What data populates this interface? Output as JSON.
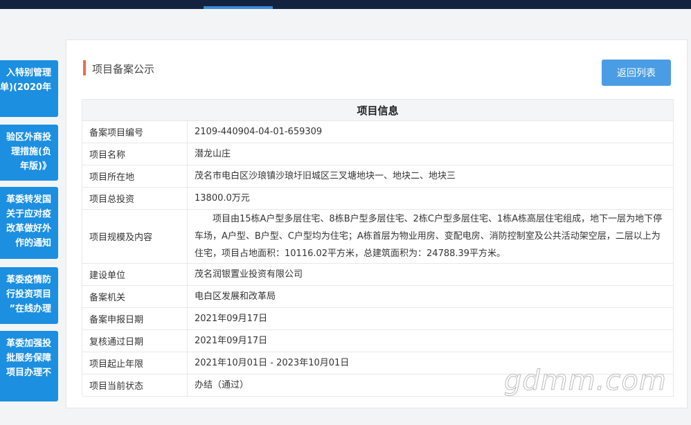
{
  "side_cards": [
    {
      "lines": [
        "入特别管理",
        "单)(2020年"
      ]
    },
    {
      "lines": [
        "验区外商投",
        "理措施(负",
        "年版)》"
      ]
    },
    {
      "lines": [
        "革委转发国",
        "关于应对疫",
        "改革做好外",
        "作的通知"
      ]
    },
    {
      "lines": [
        "革委疫情防",
        "行投资项目",
        "”在线办理"
      ]
    },
    {
      "lines": [
        "革委加强投",
        "批服务保障",
        "项目办理不"
      ]
    }
  ],
  "panel": {
    "title": "项目备案公示",
    "back_label": "返回列表"
  },
  "table": {
    "header": "项目信息",
    "rows": [
      {
        "key": "备案项目编号",
        "value": "2109-440904-04-01-659309"
      },
      {
        "key": "项目名称",
        "value": "潜龙山庄"
      },
      {
        "key": "项目所在地",
        "value": "茂名市电白区沙琅镇沙琅圩旧城区三叉塘地块一、地块二、地块三"
      },
      {
        "key": "项目总投资",
        "value": "13800.0万元"
      },
      {
        "key": "项目规模及内容",
        "value": "项目由15栋A户型多层住宅、8栋B户型多层住宅、2栋C户型多层住宅、1栋A栋高层住宅组成，地下一层为地下停车场，A户型、B户型、C户型均为住宅；A栋首层为物业用房、变配电房、消防控制室及公共活动架空层，二层以上为住宅，项目占地面积：10116.02平方米，总建筑面积为：24788.39平方米。"
      },
      {
        "key": "建设单位",
        "value": "茂名润银置业投资有限公司"
      },
      {
        "key": "备案机关",
        "value": "电白区发展和改革局"
      },
      {
        "key": "备案申报日期",
        "value": "2021年09月17日"
      },
      {
        "key": "复核通过日期",
        "value": "2021年09月17日"
      },
      {
        "key": "项目起止年限",
        "value": "2021年10月01日 - 2023年10月01日"
      },
      {
        "key": "项目当前状态",
        "value": "办结（通过）"
      }
    ]
  },
  "watermark": "gdmm.com"
}
